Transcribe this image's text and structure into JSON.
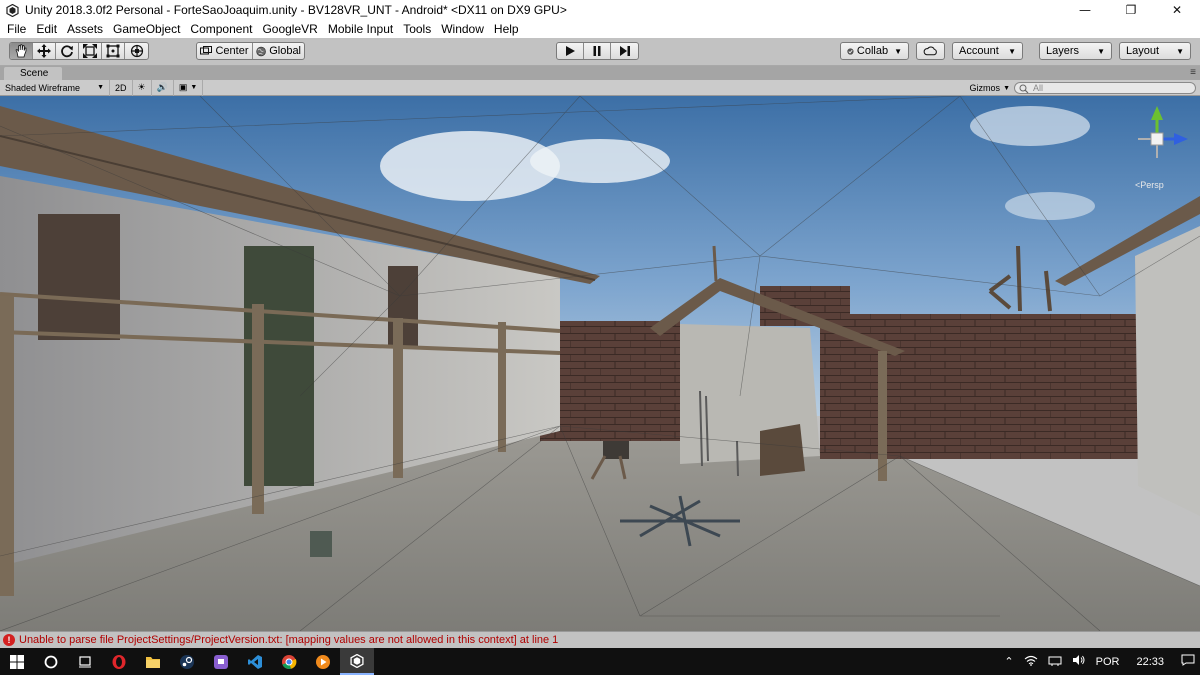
{
  "window": {
    "title": "Unity 2018.3.0f2 Personal - ForteSaoJoaquim.unity - BV128VR_UNT - Android* <DX11 on DX9 GPU>",
    "minimize": "—",
    "maximize": "❐",
    "close": "✕"
  },
  "menu": [
    "File",
    "Edit",
    "Assets",
    "GameObject",
    "Component",
    "GoogleVR",
    "Mobile Input",
    "Tools",
    "Window",
    "Help"
  ],
  "toolbar": {
    "tools": [
      "hand-tool",
      "move-tool",
      "rotate-tool",
      "scale-tool",
      "rect-tool",
      "transform-tool"
    ],
    "pivot": "Center",
    "space": "Global",
    "collab": "Collab",
    "account": "Account",
    "layers": "Layers",
    "layout": "Layout"
  },
  "scene": {
    "tab_label": "Scene",
    "shading": "Shaded Wireframe",
    "mode_2d": "2D",
    "gizmos": "Gizmos",
    "search_placeholder": "All",
    "persp_label": "<Persp"
  },
  "console": {
    "message": "Unable to parse file ProjectSettings/ProjectVersion.txt: [mapping values are not allowed in this context] at line 1"
  },
  "taskbar": {
    "language": "POR",
    "time": "22:33"
  },
  "colors": {
    "editor_gray": "#c2c2c2",
    "error_red": "#b00000",
    "gizmo_x": "#e03030",
    "gizmo_y": "#6cc030",
    "gizmo_z": "#3060e0"
  }
}
